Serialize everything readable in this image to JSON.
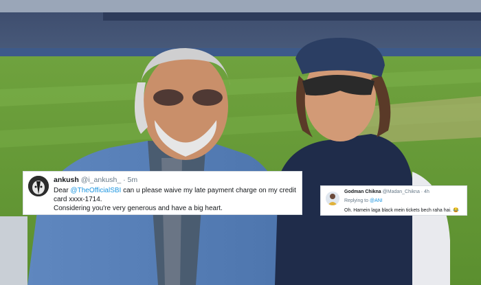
{
  "tweet_left": {
    "name": "ankush",
    "handle": "@i_ankush_",
    "time": "· 5m",
    "line1_prefix": "Dear ",
    "line1_mention": "@TheOfficialSBI",
    "line1_suffix": " can u please waive my late payment charge on my credit",
    "line2": "card xxxx-1714.",
    "line3": "Considering you're very generous and have a big heart."
  },
  "tweet_right": {
    "name": "Godman Chikna",
    "handle": "@Madan_Chikna · 4h",
    "reply_prefix": "Replying to ",
    "reply_mention": "@ANI",
    "text": "Oh. Hamein laga black mein tickets bech raha hai. 😂"
  }
}
